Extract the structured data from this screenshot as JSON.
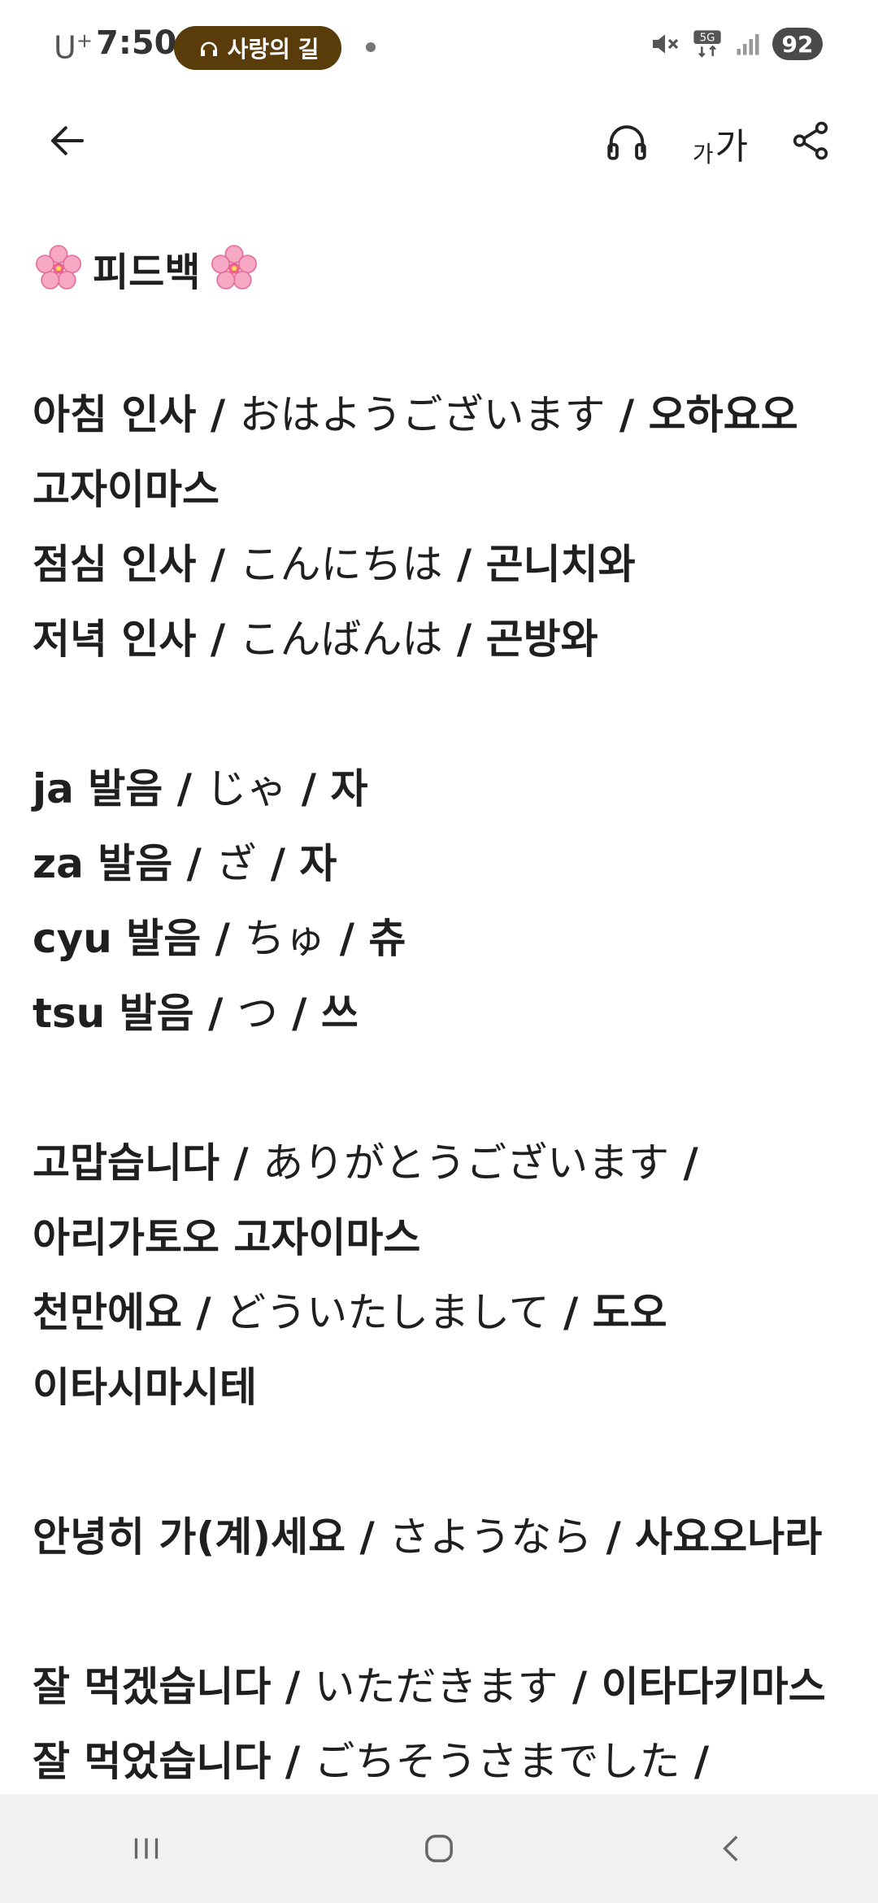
{
  "status_bar": {
    "carrier": "U",
    "carrier_sup": "+",
    "time": "7:50",
    "now_playing": "사랑의 길",
    "battery": "92",
    "network": "5G"
  },
  "app_bar": {
    "font_size_small": "가",
    "font_size_big": "가"
  },
  "post": {
    "title": "피드백",
    "groups": [
      [
        {
          "kr": "아침 인사",
          "jp": "おはようございます",
          "pron": "오하요오"
        },
        {
          "cont": "고자이마스"
        },
        {
          "kr": "점심 인사",
          "jp": "こんにちは",
          "pron": "곤니치와"
        },
        {
          "kr": "저녁 인사",
          "jp": "こんばんは",
          "pron": "곤방와"
        }
      ],
      [
        {
          "kr": "ja 발음",
          "jp": "じゃ",
          "pron": "자"
        },
        {
          "kr": "za 발음",
          "jp": "ざ",
          "pron": "자"
        },
        {
          "kr": "cyu 발음",
          "jp": "ちゅ",
          "pron": "츄"
        },
        {
          "kr": "tsu 발음",
          "jp": "つ",
          "pron": "쓰"
        }
      ],
      [
        {
          "kr": "고맙습니다",
          "jp": "ありがとうございます",
          "pron": ""
        },
        {
          "cont": "아리가토오 고자이마스"
        },
        {
          "kr": "천만에요",
          "jp": "どういたしまして",
          "pron": "도오"
        },
        {
          "cont": "이타시마시테"
        }
      ],
      [
        {
          "kr": "안녕히 가(계)세요",
          "jp": "さようなら",
          "pron": "사요오나라"
        }
      ],
      [
        {
          "kr": "잘 먹겠습니다",
          "jp": "いただきます",
          "pron": "이타다키마스"
        },
        {
          "kr": "잘 먹었습니다",
          "jp": "ごちそうさまでした",
          "pron": ""
        }
      ]
    ]
  }
}
